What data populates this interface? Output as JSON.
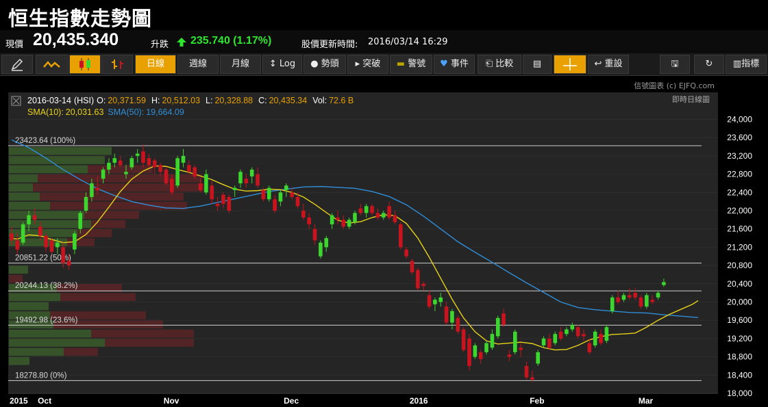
{
  "header": {
    "title": "恒生指數走勢圖"
  },
  "quote": {
    "price_label": "現價",
    "price": "20,435.340",
    "change_label": "升跌",
    "change": "235.740 (1.17%)",
    "update_label": "股價更新時間:",
    "update_time": "2016/03/14 16:29"
  },
  "toolbar": {
    "daily": "日線",
    "weekly": "週線",
    "monthly": "月線",
    "log": "Log",
    "head": "勢頭",
    "breakout": "突破",
    "warning": "警號",
    "events": "事件",
    "compare": "比較",
    "reset": "重設",
    "indicators": "指標"
  },
  "credit": "信號圖表 (c) EJFQ.com",
  "colors": {
    "up": "#3dd62f",
    "down": "#c8141e",
    "sma10": "#e8d21a",
    "sma50": "#2f8fd8",
    "bg": "#252525"
  },
  "chart_data": {
    "type": "candlestick",
    "info": {
      "date": "2016-03-14",
      "symbol": "(HSI)",
      "o_label": "O:",
      "open": "20,371.59",
      "h_label": "H:",
      "high": "20,512.03",
      "l_label": "L:",
      "low": "20,328.88",
      "c_label": "C:",
      "close": "20,435.34",
      "vol_label": "Vol:",
      "volume": "72.6 B",
      "sma10_label": "SMA(10):",
      "sma10": "20,031.63",
      "sma50_label": "SMA(50):",
      "sma50": "19,664.09"
    },
    "realtime_label": "即時日線圖",
    "ylim": [
      18000,
      24000
    ],
    "yticks": [
      "24,000",
      "23,600",
      "23,200",
      "22,800",
      "22,400",
      "22,000",
      "21,600",
      "21,200",
      "20,800",
      "20,400",
      "20,000",
      "19,600",
      "19,200",
      "18,800",
      "18,400",
      "18,000"
    ],
    "xticks": [
      {
        "label": "2015",
        "i": 0
      },
      {
        "label": "Oct",
        "i": 6
      },
      {
        "label": "Nov",
        "i": 28
      },
      {
        "label": "Dec",
        "i": 49
      },
      {
        "label": "2016",
        "i": 71
      },
      {
        "label": "Feb",
        "i": 92
      },
      {
        "label": "Mar",
        "i": 111
      }
    ],
    "fib_levels": [
      {
        "value": 23423.64,
        "label": "23423.64 (100%)"
      },
      {
        "value": 20851.22,
        "label": "20851.22 (50%)"
      },
      {
        "value": 20244.13,
        "label": "20244.13 (38.2%)"
      },
      {
        "value": 19492.98,
        "label": "19492.98 (23.6%)"
      },
      {
        "value": 18278.8,
        "label": "18278.80 (0%)"
      }
    ],
    "candles": [
      [
        21500,
        21650,
        21250,
        21350
      ],
      [
        21350,
        21500,
        21050,
        21150
      ],
      [
        21300,
        21750,
        21250,
        21700
      ],
      [
        21700,
        22000,
        21550,
        21900
      ],
      [
        21900,
        22050,
        21700,
        21800
      ],
      [
        21650,
        21750,
        21350,
        21450
      ],
      [
        21450,
        21500,
        21100,
        21200
      ],
      [
        21350,
        21400,
        21050,
        21100
      ],
      [
        21200,
        21400,
        21050,
        21300
      ],
      [
        21200,
        21300,
        20750,
        20850
      ],
      [
        20900,
        21050,
        20700,
        20800
      ],
      [
        21150,
        21550,
        21050,
        21500
      ],
      [
        21600,
        22000,
        21500,
        21950
      ],
      [
        22000,
        22400,
        21950,
        22300
      ],
      [
        22300,
        22700,
        22200,
        22600
      ],
      [
        22500,
        22750,
        22350,
        22450
      ],
      [
        22700,
        22950,
        22600,
        22900
      ],
      [
        22900,
        23150,
        22800,
        23050
      ],
      [
        23050,
        23250,
        22950,
        23150
      ],
      [
        23100,
        23200,
        22950,
        23000
      ],
      [
        22800,
        23000,
        22700,
        22850
      ],
      [
        22950,
        23200,
        22900,
        23150
      ],
      [
        23200,
        23350,
        23050,
        23250
      ],
      [
        23300,
        23450,
        22950,
        23050
      ],
      [
        23150,
        23250,
        22950,
        23000
      ],
      [
        23100,
        23150,
        22800,
        22950
      ],
      [
        23000,
        23050,
        22750,
        22850
      ],
      [
        22900,
        22950,
        22550,
        22600
      ],
      [
        22700,
        22800,
        22350,
        22400
      ],
      [
        22550,
        23200,
        22500,
        23150
      ],
      [
        23050,
        23350,
        22950,
        23200
      ],
      [
        23000,
        23100,
        22800,
        22850
      ],
      [
        22950,
        23000,
        22700,
        22750
      ],
      [
        22600,
        22700,
        22400,
        22450
      ],
      [
        22400,
        22900,
        22350,
        22800
      ],
      [
        22550,
        22650,
        22150,
        22250
      ],
      [
        22150,
        22300,
        22000,
        22100
      ],
      [
        22350,
        22400,
        22050,
        22150
      ],
      [
        22300,
        22350,
        21950,
        22000
      ],
      [
        22450,
        22550,
        22300,
        22500
      ],
      [
        22600,
        22900,
        22500,
        22850
      ],
      [
        22700,
        22800,
        22500,
        22600
      ],
      [
        22750,
        22950,
        22600,
        22900
      ],
      [
        22800,
        22950,
        22500,
        22550
      ],
      [
        22450,
        22500,
        22200,
        22250
      ],
      [
        22250,
        22550,
        22200,
        22500
      ],
      [
        22250,
        22350,
        21950,
        22000
      ],
      [
        22200,
        22450,
        22100,
        22400
      ],
      [
        22450,
        22600,
        22300,
        22550
      ],
      [
        22400,
        22500,
        22250,
        22300
      ],
      [
        22300,
        22400,
        22050,
        22100
      ],
      [
        22000,
        22150,
        21800,
        21850
      ],
      [
        21850,
        21950,
        21600,
        21700
      ],
      [
        21600,
        21700,
        21250,
        21350
      ],
      [
        21000,
        21350,
        20950,
        21300
      ],
      [
        21200,
        21450,
        21100,
        21400
      ],
      [
        21700,
        21950,
        21600,
        21900
      ],
      [
        21850,
        22000,
        21700,
        21800
      ],
      [
        21800,
        21900,
        21600,
        21650
      ],
      [
        21650,
        21850,
        21600,
        21800
      ],
      [
        21750,
        22000,
        21700,
        21950
      ],
      [
        22050,
        22150,
        21900,
        21950
      ],
      [
        21950,
        22150,
        21850,
        22100
      ],
      [
        22100,
        22150,
        21900,
        21950
      ],
      [
        21950,
        22050,
        21800,
        21850
      ],
      [
        21850,
        22000,
        21800,
        21950
      ],
      [
        22100,
        22200,
        21800,
        21850
      ],
      [
        21900,
        22000,
        21700,
        21750
      ],
      [
        21700,
        21750,
        21150,
        21200
      ],
      [
        21150,
        21200,
        20950,
        21000
      ],
      [
        20900,
        20950,
        20600,
        20650
      ],
      [
        20700,
        20750,
        20250,
        20300
      ],
      [
        20400,
        20450,
        20250,
        20350
      ],
      [
        20150,
        20250,
        19850,
        19900
      ],
      [
        19950,
        20100,
        19800,
        20050
      ],
      [
        20000,
        20200,
        19900,
        20100
      ],
      [
        19900,
        20000,
        19500,
        19550
      ],
      [
        19550,
        19850,
        19400,
        19800
      ],
      [
        19650,
        19700,
        19300,
        19350
      ],
      [
        19400,
        19450,
        18900,
        18950
      ],
      [
        19200,
        19300,
        18500,
        18600
      ],
      [
        18800,
        19100,
        18750,
        19050
      ],
      [
        18900,
        18950,
        18650,
        18750
      ],
      [
        18900,
        19150,
        18850,
        19100
      ],
      [
        19000,
        19400,
        18950,
        19300
      ],
      [
        19250,
        19700,
        19200,
        19650
      ],
      [
        19750,
        19850,
        19450,
        19500
      ],
      [
        18850,
        18950,
        18700,
        18800
      ],
      [
        18900,
        19400,
        18850,
        19350
      ],
      [
        19000,
        19100,
        18800,
        18950
      ],
      [
        18600,
        18700,
        18300,
        18350
      ],
      [
        18350,
        18500,
        18250,
        18300
      ],
      [
        18650,
        18950,
        18600,
        18900
      ],
      [
        19050,
        19250,
        19000,
        19200
      ],
      [
        19200,
        19300,
        18950,
        19000
      ],
      [
        19100,
        19350,
        19050,
        19300
      ],
      [
        19350,
        19450,
        19150,
        19200
      ],
      [
        19300,
        19450,
        19250,
        19400
      ],
      [
        19400,
        19550,
        19350,
        19500
      ],
      [
        19450,
        19500,
        19200,
        19250
      ],
      [
        19300,
        19400,
        19150,
        19250
      ],
      [
        19100,
        19200,
        18850,
        18900
      ],
      [
        19050,
        19400,
        19000,
        19350
      ],
      [
        19300,
        19400,
        19050,
        19100
      ],
      [
        19150,
        19500,
        19100,
        19450
      ],
      [
        19800,
        20150,
        19750,
        20100
      ],
      [
        20100,
        20250,
        19950,
        20000
      ],
      [
        20050,
        20200,
        20000,
        20150
      ],
      [
        20150,
        20300,
        20050,
        20100
      ],
      [
        20200,
        20300,
        20050,
        20100
      ],
      [
        20100,
        20150,
        19850,
        19900
      ],
      [
        19900,
        20200,
        19850,
        20150
      ],
      [
        20050,
        20150,
        19950,
        20000
      ],
      [
        20100,
        20250,
        20050,
        20200
      ],
      [
        20371.59,
        20512.03,
        20328.88,
        20435.34
      ]
    ],
    "sma10": [
      [
        0,
        21400
      ],
      [
        1,
        21380
      ],
      [
        3,
        21470
      ],
      [
        5,
        21450
      ],
      [
        7,
        21370
      ],
      [
        9,
        21300
      ],
      [
        11,
        21320
      ],
      [
        13,
        21480
      ],
      [
        15,
        21750
      ],
      [
        17,
        22080
      ],
      [
        19,
        22420
      ],
      [
        21,
        22690
      ],
      [
        23,
        22870
      ],
      [
        25,
        22980
      ],
      [
        27,
        22970
      ],
      [
        29,
        22900
      ],
      [
        31,
        22840
      ],
      [
        33,
        22760
      ],
      [
        35,
        22680
      ],
      [
        37,
        22570
      ],
      [
        39,
        22470
      ],
      [
        41,
        22430
      ],
      [
        43,
        22440
      ],
      [
        45,
        22470
      ],
      [
        47,
        22460
      ],
      [
        49,
        22400
      ],
      [
        51,
        22300
      ],
      [
        53,
        22140
      ],
      [
        55,
        21960
      ],
      [
        57,
        21790
      ],
      [
        59,
        21730
      ],
      [
        61,
        21760
      ],
      [
        63,
        21850
      ],
      [
        65,
        21910
      ],
      [
        67,
        21890
      ],
      [
        69,
        21720
      ],
      [
        71,
        21400
      ],
      [
        73,
        20980
      ],
      [
        75,
        20520
      ],
      [
        77,
        20060
      ],
      [
        79,
        19650
      ],
      [
        81,
        19350
      ],
      [
        83,
        19150
      ],
      [
        85,
        19080
      ],
      [
        87,
        19100
      ],
      [
        89,
        19120
      ],
      [
        91,
        19090
      ],
      [
        93,
        19000
      ],
      [
        95,
        18950
      ],
      [
        97,
        18960
      ],
      [
        99,
        19050
      ],
      [
        101,
        19170
      ],
      [
        103,
        19240
      ],
      [
        105,
        19290
      ],
      [
        107,
        19300
      ],
      [
        109,
        19320
      ],
      [
        111,
        19450
      ],
      [
        113,
        19600
      ],
      [
        115,
        19730
      ],
      [
        117,
        19840
      ],
      [
        119,
        19950
      ],
      [
        120,
        20030
      ]
    ],
    "sma50": [
      [
        0,
        23550
      ],
      [
        3,
        23380
      ],
      [
        6,
        23150
      ],
      [
        9,
        22900
      ],
      [
        12,
        22680
      ],
      [
        15,
        22480
      ],
      [
        18,
        22330
      ],
      [
        21,
        22200
      ],
      [
        24,
        22120
      ],
      [
        27,
        22060
      ],
      [
        30,
        22050
      ],
      [
        33,
        22100
      ],
      [
        36,
        22180
      ],
      [
        39,
        22260
      ],
      [
        42,
        22340
      ],
      [
        45,
        22420
      ],
      [
        48,
        22470
      ],
      [
        51,
        22520
      ],
      [
        54,
        22530
      ],
      [
        57,
        22510
      ],
      [
        60,
        22490
      ],
      [
        63,
        22420
      ],
      [
        66,
        22310
      ],
      [
        69,
        22130
      ],
      [
        72,
        21880
      ],
      [
        75,
        21600
      ],
      [
        78,
        21320
      ],
      [
        81,
        21090
      ],
      [
        84,
        20870
      ],
      [
        87,
        20640
      ],
      [
        90,
        20420
      ],
      [
        93,
        20210
      ],
      [
        96,
        20000
      ],
      [
        99,
        19880
      ],
      [
        102,
        19830
      ],
      [
        105,
        19800
      ],
      [
        108,
        19770
      ],
      [
        111,
        19760
      ],
      [
        114,
        19720
      ],
      [
        117,
        19690
      ],
      [
        120,
        19660
      ]
    ],
    "volume_profile": [
      {
        "y": 23300,
        "u": 150,
        "d": 0
      },
      {
        "y": 23100,
        "u": 140,
        "d": 0
      },
      {
        "y": 22900,
        "u": 115,
        "d": 95
      },
      {
        "y": 22700,
        "u": 42,
        "d": 240
      },
      {
        "y": 22500,
        "u": 35,
        "d": 250
      },
      {
        "y": 22300,
        "u": 45,
        "d": 210
      },
      {
        "y": 22100,
        "u": 60,
        "d": 200
      },
      {
        "y": 21900,
        "u": 110,
        "d": 80
      },
      {
        "y": 21700,
        "u": 120,
        "d": 50
      },
      {
        "y": 21500,
        "u": 100,
        "d": 50
      },
      {
        "y": 21300,
        "u": 85,
        "d": 40
      },
      {
        "y": 20700,
        "u": 28,
        "d": 0
      },
      {
        "y": 20500,
        "u": 0,
        "d": 20
      },
      {
        "y": 20300,
        "u": 70,
        "d": 95
      },
      {
        "y": 20100,
        "u": 75,
        "d": 110
      },
      {
        "y": 19900,
        "u": 58,
        "d": 0
      },
      {
        "y": 19700,
        "u": 60,
        "d": 140
      },
      {
        "y": 19500,
        "u": 65,
        "d": 160
      },
      {
        "y": 19300,
        "u": 120,
        "d": 150
      },
      {
        "y": 19100,
        "u": 140,
        "d": 130
      },
      {
        "y": 18900,
        "u": 80,
        "d": 50
      },
      {
        "y": 18700,
        "u": 30,
        "d": 0
      }
    ]
  }
}
